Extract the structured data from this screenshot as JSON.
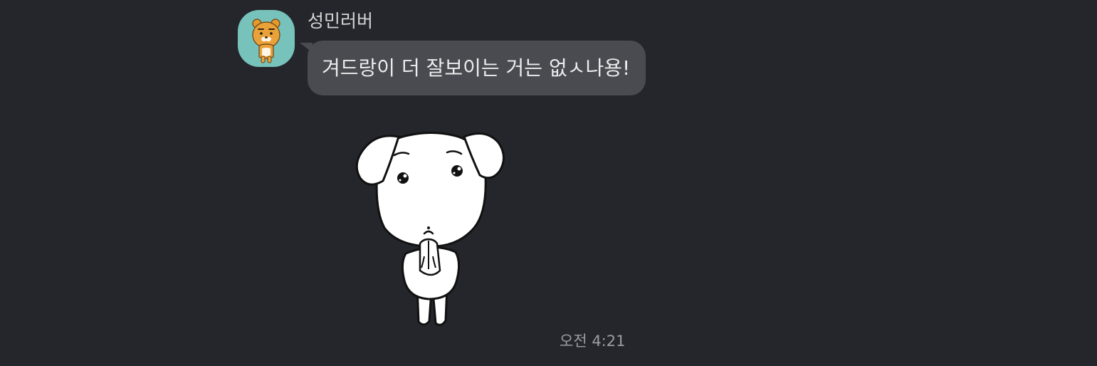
{
  "chat": {
    "sender_name": "성민러버",
    "message_text": "겨드랑이 더 잘보이는 거는 없ㅅ나용!",
    "timestamp": "오전 4:21"
  },
  "icons": {
    "avatar": "profile-avatar-icon",
    "sticker": "puppy-pleading-sticker-icon"
  },
  "colors": {
    "background": "#25262c",
    "bubble": "#4a4b51",
    "avatar_bg": "#77c3bb"
  }
}
